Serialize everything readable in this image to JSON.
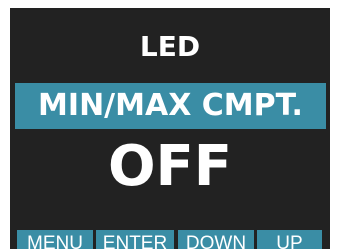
{
  "screen": {
    "title": "LED",
    "selected_item": "MIN/MAX CMPT.",
    "value": "OFF"
  },
  "softkeys": {
    "menu": "MENU",
    "enter": "ENTER",
    "down": "DOWN",
    "up": "UP"
  },
  "colors": {
    "background": "#222222",
    "highlight": "#3a8da5",
    "text": "#ffffff"
  }
}
